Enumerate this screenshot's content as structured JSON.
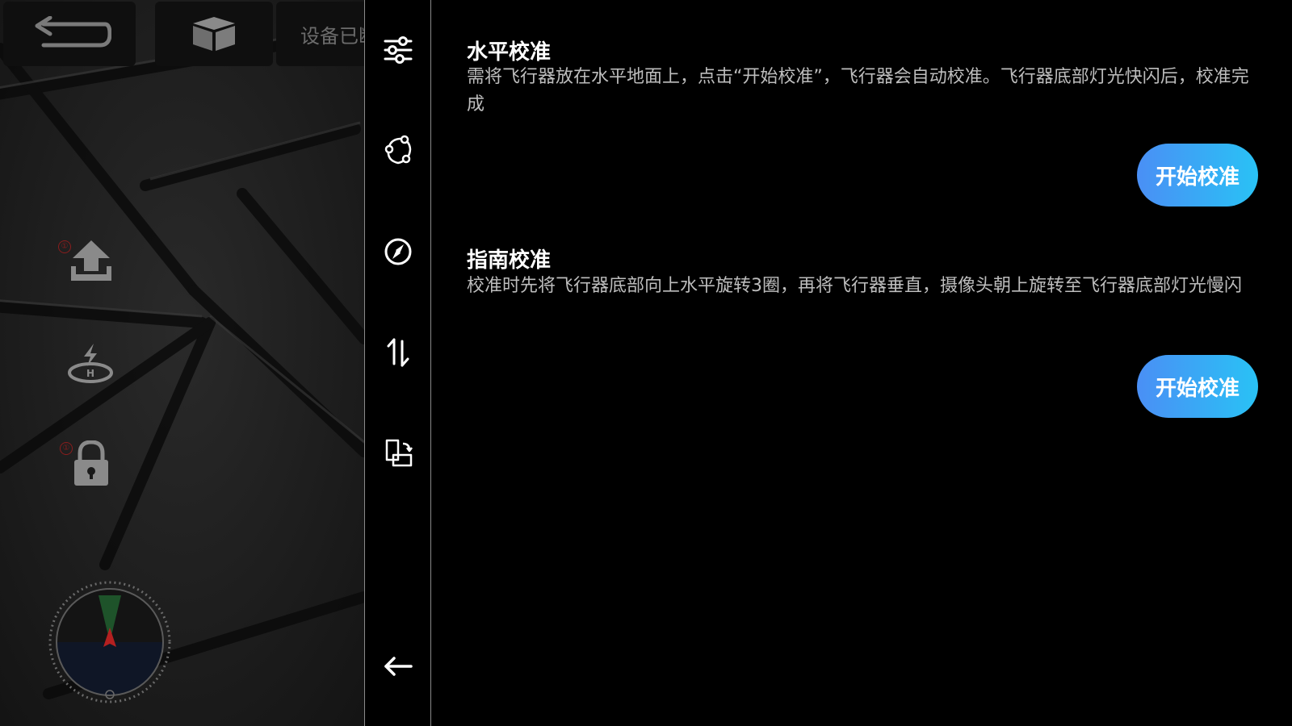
{
  "flight_view": {
    "status_text": "设备已断开",
    "warn_upload": "①",
    "warn_lock": "①",
    "icons": [
      "back-arrow-icon",
      "cube-icon",
      "takeoff-icon",
      "return-home-icon",
      "lock-icon",
      "compass-radar-icon"
    ]
  },
  "rail": {
    "items": [
      {
        "icon": "sliders-icon"
      },
      {
        "icon": "gyro-calibration-icon"
      },
      {
        "icon": "compass-icon"
      },
      {
        "icon": "up-down-arrows-icon"
      },
      {
        "icon": "rotate-screen-icon"
      },
      {
        "icon": "collapse-arrow-icon"
      }
    ]
  },
  "calibration": {
    "horizontal": {
      "title": "水平校准",
      "description": "需将飞行器放在水平地面上，点击“开始校准”，飞行器会自动校准。飞行器底部灯光快闪后，校准完成",
      "button": "开始校准"
    },
    "compass": {
      "title": "指南校准",
      "description": "校准时先将飞行器底部向上水平旋转3圈，再将飞行器垂直，摄像头朝上旋转至飞行器底部灯光慢闪",
      "button": "开始校准"
    }
  },
  "colors": {
    "accent_start": "#4a8ff5",
    "accent_end": "#29c2f5",
    "warning": "#8a1d1d",
    "rail_border": "#8a8a8a"
  }
}
